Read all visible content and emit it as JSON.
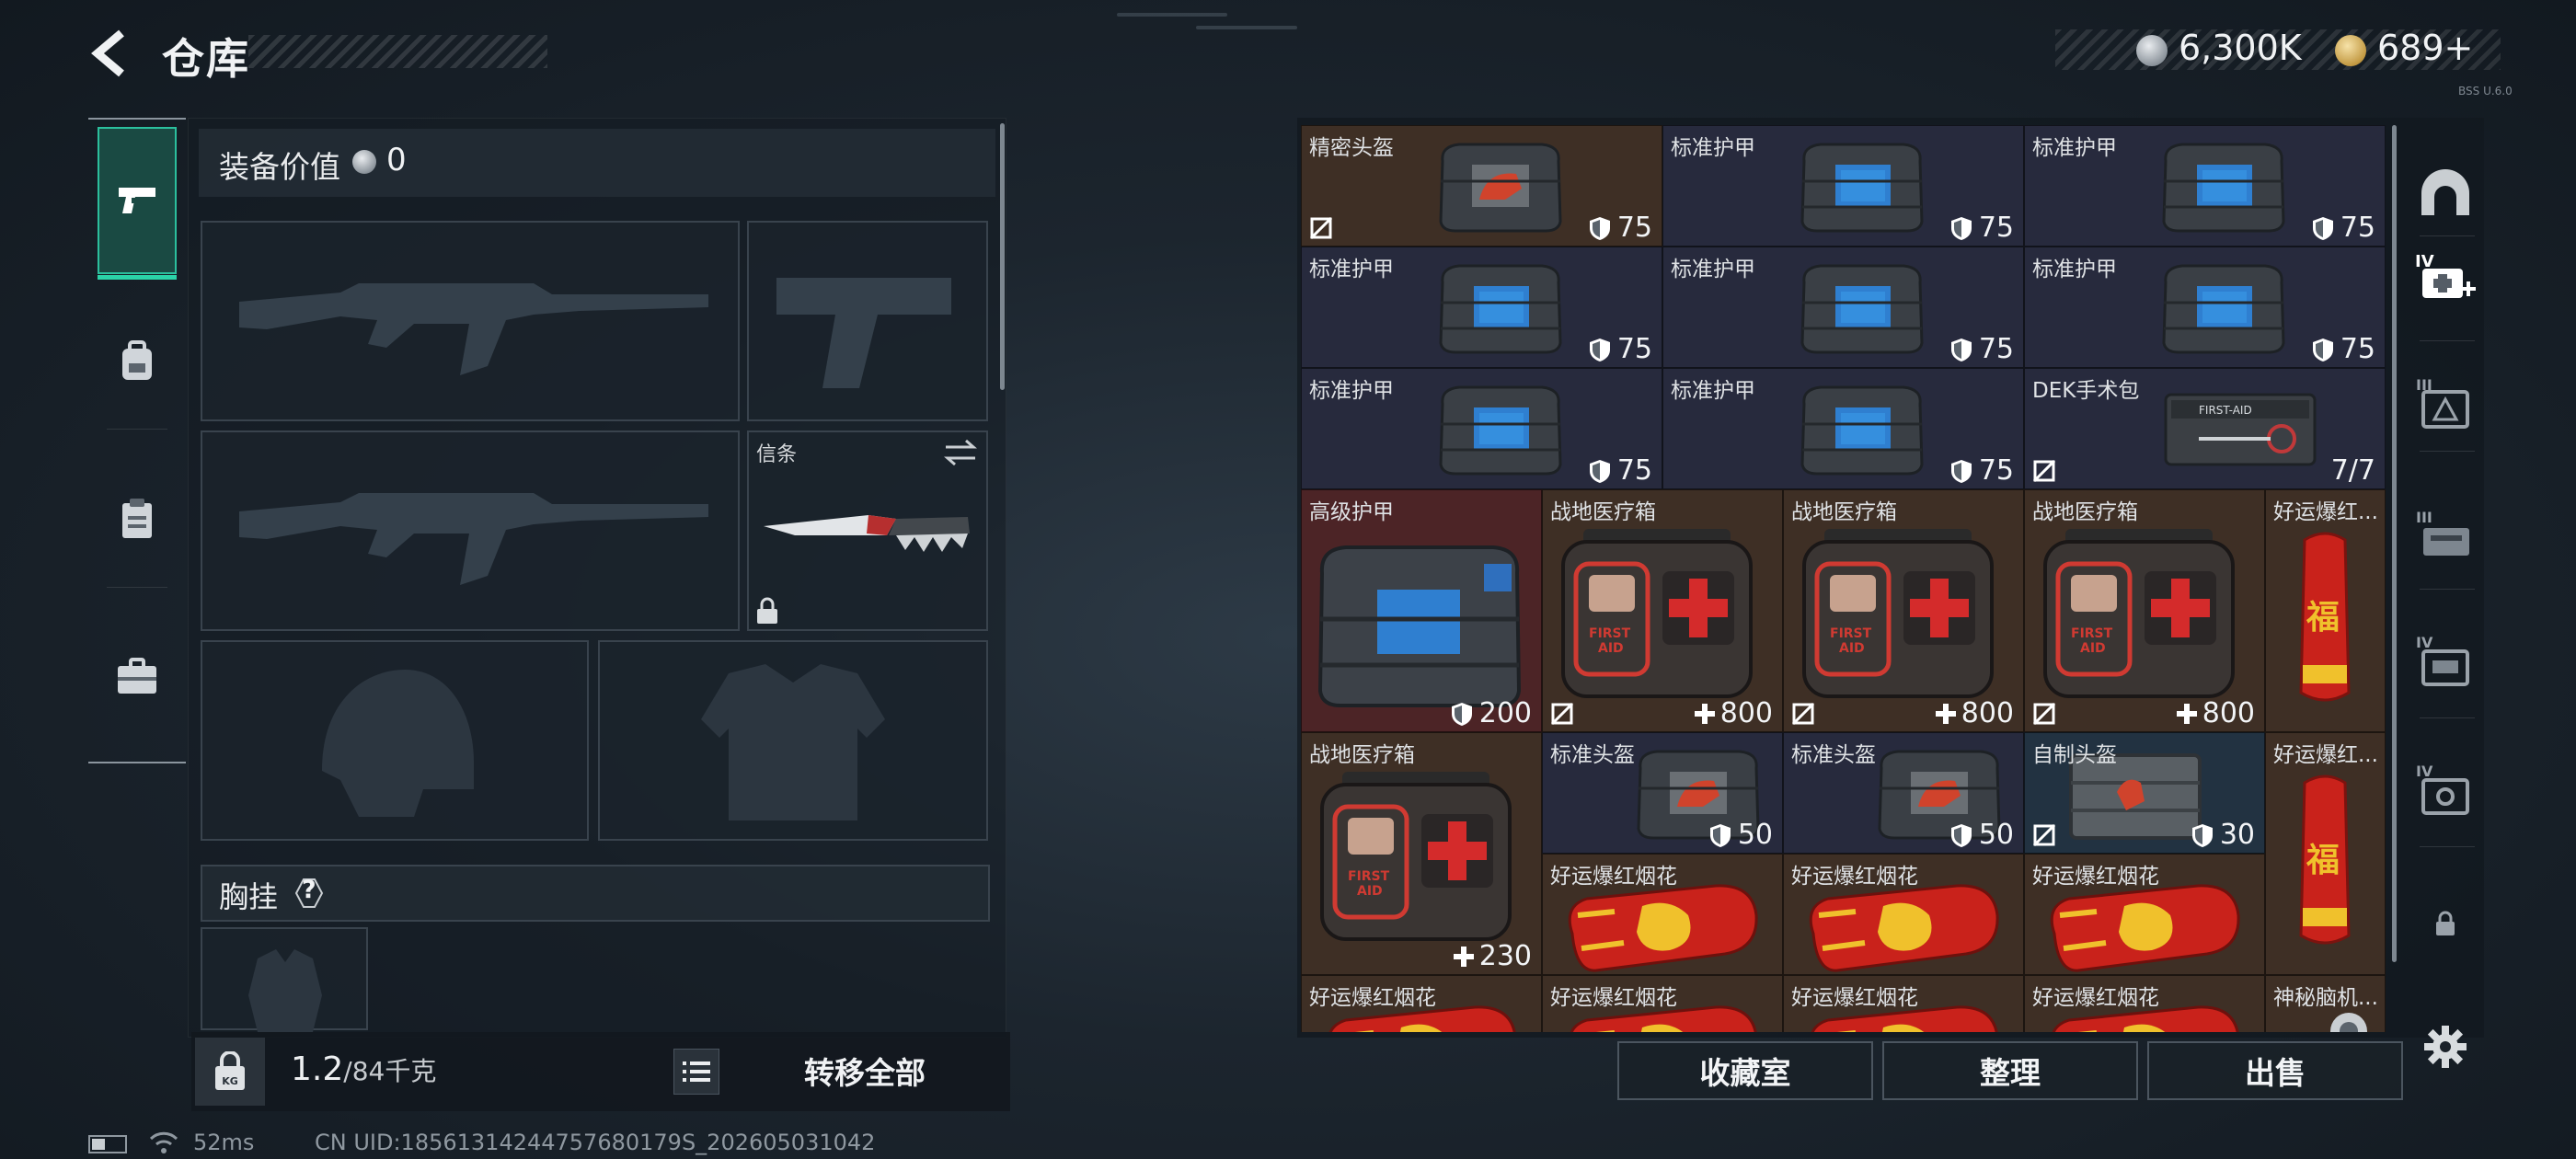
{
  "header": {
    "title": "仓库"
  },
  "currency": {
    "coins": "6,300K",
    "premium": "689",
    "premium_plus": "+",
    "tiny_version": "BSS U.6.0"
  },
  "nav": {
    "items": [
      {
        "name": "weapons",
        "icon": "pistol-icon",
        "active": true
      },
      {
        "name": "bag",
        "icon": "backpack-icon",
        "active": false
      },
      {
        "name": "clipboard",
        "icon": "clipboard-icon",
        "active": false
      },
      {
        "name": "case",
        "icon": "briefcase-icon",
        "active": false
      }
    ]
  },
  "loadout": {
    "gear_value_label": "装备价值",
    "gear_value": "0",
    "slots": {
      "primary1": "rifle-silhouette",
      "secondary": "pistol-silhouette",
      "primary2": "rifle-silhouette",
      "melee_label": "信条",
      "helmet": "helmet-silhouette",
      "armor": "armor-silhouette"
    },
    "chest_rig_label": "胸挂",
    "chest_rig_help": "?"
  },
  "weight": {
    "current": "1.2",
    "capacity": "/84千克",
    "icon": "kg-lock-icon"
  },
  "transfer_all_label": "转移全部",
  "status": {
    "ping": "52ms",
    "uid": "CN UID:18561314244757680179S_202605031042"
  },
  "stash": {
    "items": [
      {
        "name": "精密头盔",
        "value": "75",
        "value_icon": "shield",
        "noflag": true
      },
      {
        "name": "标准护甲",
        "value": "75",
        "value_icon": "shield",
        "noflag": false
      },
      {
        "name": "标准护甲",
        "value": "75",
        "value_icon": "shield",
        "noflag": false
      },
      {
        "name": "标准护甲",
        "value": "75",
        "value_icon": "shield",
        "noflag": false
      },
      {
        "name": "标准护甲",
        "value": "75",
        "value_icon": "shield",
        "noflag": false
      },
      {
        "name": "标准护甲",
        "value": "75",
        "value_icon": "shield",
        "noflag": false
      },
      {
        "name": "标准护甲",
        "value": "75",
        "value_icon": "shield",
        "noflag": false
      },
      {
        "name": "标准护甲",
        "value": "75",
        "value_icon": "shield",
        "noflag": false
      },
      {
        "name": "DEK手术包",
        "value": "7/7",
        "value_icon": "",
        "noflag": true
      },
      {
        "name": "高级护甲",
        "value": "200",
        "value_icon": "shield",
        "noflag": false
      },
      {
        "name": "战地医疗箱",
        "value": "800",
        "value_icon": "plus",
        "noflag": true
      },
      {
        "name": "战地医疗箱",
        "value": "800",
        "value_icon": "plus",
        "noflag": true
      },
      {
        "name": "战地医疗箱",
        "value": "800",
        "value_icon": "plus",
        "noflag": true
      },
      {
        "name": "好运爆红...",
        "value": "",
        "value_icon": "",
        "noflag": false
      },
      {
        "name": "战地医疗箱",
        "value": "230",
        "value_icon": "plus",
        "noflag": false
      },
      {
        "name": "标准头盔",
        "value": "50",
        "value_icon": "shield",
        "noflag": false
      },
      {
        "name": "标准头盔",
        "value": "50",
        "value_icon": "shield",
        "noflag": false
      },
      {
        "name": "自制头盔",
        "value": "30",
        "value_icon": "shield",
        "noflag": true
      },
      {
        "name": "好运爆红...",
        "value": "",
        "value_icon": "",
        "noflag": false
      },
      {
        "name": "好运爆红烟花",
        "value": "",
        "value_icon": "",
        "noflag": false
      },
      {
        "name": "好运爆红烟花",
        "value": "",
        "value_icon": "",
        "noflag": false
      },
      {
        "name": "好运爆红烟花",
        "value": "",
        "value_icon": "",
        "noflag": false
      },
      {
        "name": "好运爆红烟花",
        "value": "",
        "value_icon": "",
        "noflag": false
      },
      {
        "name": "好运爆红烟花",
        "value": "",
        "value_icon": "",
        "noflag": false
      },
      {
        "name": "好运爆红烟花",
        "value": "",
        "value_icon": "",
        "noflag": false
      },
      {
        "name": "好运爆红烟花",
        "value": "",
        "value_icon": "",
        "noflag": false
      },
      {
        "name": "神秘脑机...",
        "value": "",
        "value_icon": "",
        "noflag": false
      }
    ]
  },
  "buttons": {
    "collection": "收藏室",
    "organize": "整理",
    "sell": "出售"
  },
  "side_tabs": [
    {
      "icon": "dome-icon"
    },
    {
      "icon": "medkit-plus-icon",
      "tier": "IV"
    },
    {
      "icon": "case-triangle-icon",
      "tier": "III"
    },
    {
      "icon": "case-stack-icon",
      "tier": "III"
    },
    {
      "icon": "case-folder-icon",
      "tier": "IV"
    },
    {
      "icon": "case-gear-icon",
      "tier": "IV"
    },
    {
      "icon": "lock-icon"
    },
    {
      "icon": "settings-gear-icon"
    }
  ]
}
